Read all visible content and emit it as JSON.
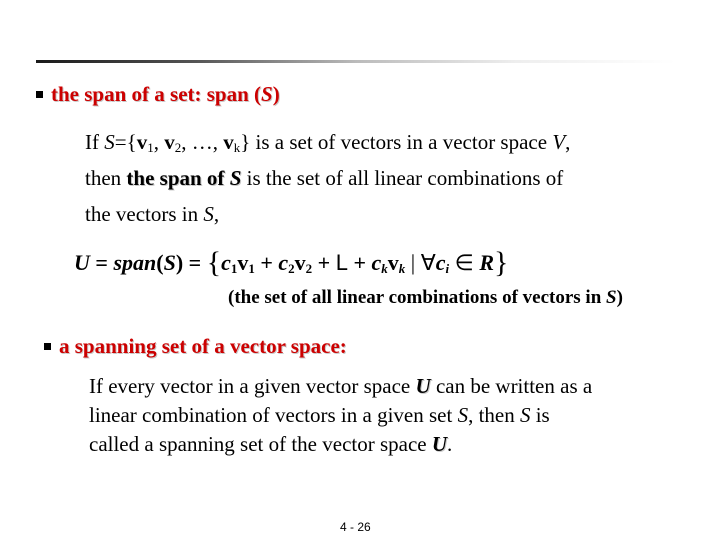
{
  "slide": {
    "heading1": {
      "text_pre": "the span of a set:  span (",
      "text_var": "S",
      "text_post": ")"
    },
    "definition": {
      "line1_if": "If ",
      "line1_S": "S",
      "line1_eq": "={",
      "v": "v",
      "sub1": "1",
      "sub2": "2",
      "subk": "k",
      "sep": ", ",
      "ellipsis": ", …, ",
      "line1_rest": "} is a set of vectors in a vector space ",
      "line1_V": "V",
      "line1_end": ",",
      "line2_then": "then ",
      "line2_bold": "the span of ",
      "line2_S": "S",
      "line2_rest": "  is the set of all linear combinations of",
      "line3_pre": "the vectors in ",
      "line3_S": "S",
      "line3_end": ","
    },
    "formula": {
      "U": "U",
      "eq1": " = ",
      "span": "span",
      "S": "S",
      "eq2": " = ",
      "lbrace": "{",
      "c": "c",
      "v": "v",
      "sub1": "1",
      "sub2": "2",
      "subk": "k",
      "subi": "i",
      "plus": " + ",
      "dots": "L",
      "bar": "  |  ",
      "forall": "∀",
      "in": " ∈ ",
      "R": "R",
      "rbrace": "}"
    },
    "caption": {
      "pre": "(the  set of all linear combinations of vectors  in ",
      "S": "S",
      "post": ")"
    },
    "heading2": {
      "text": "a spanning set of a vector space:"
    },
    "definition2": {
      "l1_pre": "If every vector in a given vector space ",
      "l1_U": "U",
      "l1_post": " can be written as a",
      "l2_pre": "linear combination of vectors in a given set ",
      "l2_S1": "S",
      "l2_mid": ", then ",
      "l2_S2": "S",
      "l2_post": " is",
      "l3_pre": "called a spanning set of the vector space ",
      "l3_U": "U",
      "l3_post": "."
    },
    "page_number": "4 - 26"
  }
}
